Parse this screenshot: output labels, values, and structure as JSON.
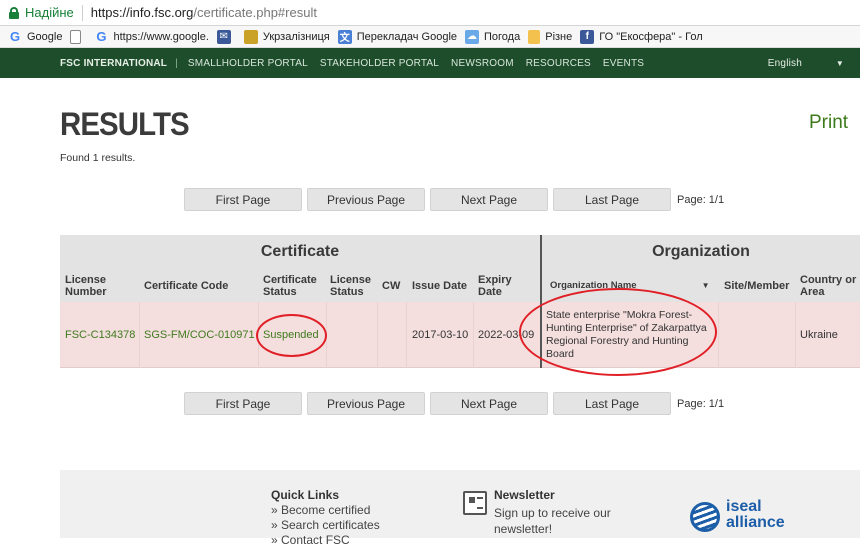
{
  "browser": {
    "security_label": "Надійне",
    "url_main": "https://info.fsc.org",
    "url_path": "/certificate.php#result",
    "bookmarks": [
      {
        "label": "Google",
        "icon": "google-icon"
      },
      {
        "label": "",
        "icon": "document-icon"
      },
      {
        "label": "https://www.google.",
        "icon": "google-icon"
      },
      {
        "label": "",
        "icon": "mail-icon"
      },
      {
        "label": "Укрзалізниця",
        "icon": "ukrzaliznytsia-icon"
      },
      {
        "label": "Перекладач Google",
        "icon": "translate-icon"
      },
      {
        "label": "Погода",
        "icon": "weather-icon"
      },
      {
        "label": "Різне",
        "icon": "folder-icon"
      },
      {
        "label": "ГО \"Екосфера\" - Гол",
        "icon": "facebook-icon"
      }
    ]
  },
  "nav": {
    "brand": "FSC INTERNATIONAL",
    "separator": "|",
    "links": [
      "SMALLHOLDER PORTAL",
      "STAKEHOLDER PORTAL",
      "NEWSROOM",
      "RESOURCES",
      "EVENTS"
    ],
    "language": "English",
    "language_arrow": "▼"
  },
  "page": {
    "title": "RESULTS",
    "print_label": "Print",
    "found_text": "Found 1 results."
  },
  "pagination": {
    "first": "First Page",
    "previous": "Previous Page",
    "next": "Next Page",
    "last": "Last Page",
    "info": "Page: 1/1"
  },
  "table": {
    "group_certificate": "Certificate",
    "group_organization": "Organization",
    "headers": {
      "license_number": "License Number",
      "certificate_code": "Certificate Code",
      "certificate_status": "Certificate Status",
      "license_status": "License Status",
      "cw": "CW",
      "issue_date": "Issue Date",
      "expiry_date": "Expiry Date",
      "organization_name": "Organization Name",
      "sort_arrow": "▼",
      "site_member": "Site/Member",
      "country": "Country or Area"
    },
    "rows": [
      {
        "license_number": "FSC-C134378",
        "certificate_code": "SGS-FM/COC-010971",
        "certificate_status": "Suspended",
        "license_status": "",
        "cw": "",
        "issue_date": "2017-03-10",
        "expiry_date": "2022-03-09",
        "organization_name": "State enterprise \"Mokra Forest-Hunting Enterprise\" of Zakarpattya Regional Forestry and Hunting Board",
        "site_member": "",
        "country": "Ukraine"
      }
    ]
  },
  "footer": {
    "quick_links_title": "Quick Links",
    "quick_links": [
      "» Become certified",
      "» Search certificates",
      "» Contact FSC"
    ],
    "newsletter_title": "Newsletter",
    "newsletter_text": "Sign up to receive our newsletter!",
    "iseal_line1": "iseal",
    "iseal_line2": "alliance"
  },
  "colors": {
    "nav_green": "#1e4d2b",
    "link_green": "#3e7a1c",
    "row_highlight": "#f4dede",
    "annotation_red": "#e01f26"
  }
}
